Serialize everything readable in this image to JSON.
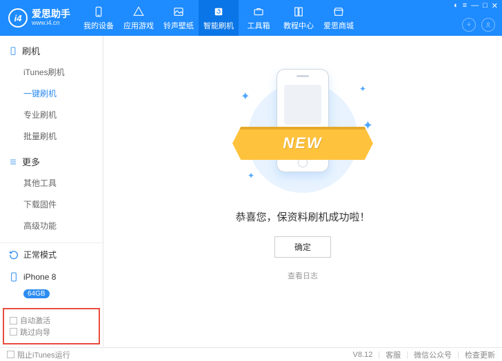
{
  "brand": {
    "name": "爱思助手",
    "site": "www.i4.cn",
    "logo_mark": "i4"
  },
  "topnav": {
    "items": [
      {
        "label": "我的设备"
      },
      {
        "label": "应用游戏"
      },
      {
        "label": "铃声壁纸"
      },
      {
        "label": "智能刷机"
      },
      {
        "label": "工具箱"
      },
      {
        "label": "教程中心"
      },
      {
        "label": "爱思商城"
      }
    ],
    "active_index": 3
  },
  "sidebar": {
    "groups": [
      {
        "title": "刷机",
        "items": [
          "iTunes刷机",
          "一键刷机",
          "专业刷机",
          "批量刷机"
        ],
        "active_index": 1
      },
      {
        "title": "更多",
        "items": [
          "其他工具",
          "下载固件",
          "高级功能"
        ],
        "active_index": -1
      }
    ],
    "mode": "正常模式",
    "device": {
      "name": "iPhone 8",
      "storage": "64GB"
    },
    "options": {
      "auto_activate": "自动激活",
      "skip_wizard": "跳过向导"
    }
  },
  "main": {
    "ribbon": "NEW",
    "message": "恭喜您，保资料刷机成功啦！",
    "ok": "确定",
    "view_log": "查看日志"
  },
  "footer": {
    "block_itunes": "阻止iTunes运行",
    "version": "V8.12",
    "links": [
      "客服",
      "微信公众号",
      "检查更新"
    ]
  }
}
